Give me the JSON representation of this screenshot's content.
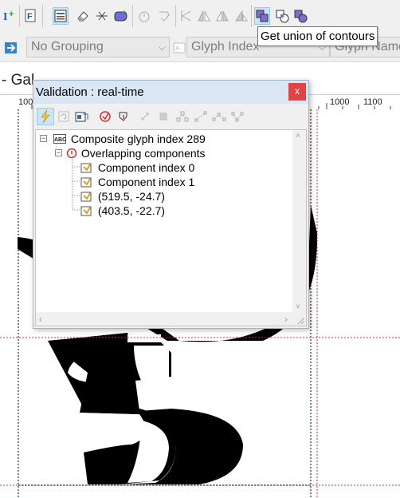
{
  "toolbar": {
    "tooltip": "Get union of contours",
    "icons": [
      "insert-point-icon",
      "font-info-icon",
      "glyph-list-icon",
      "eraser-icon",
      "split-icon",
      "add-component-icon",
      "timer-icon",
      "transform-icon",
      "align-left-icon",
      "flip-horizontal-icon",
      "flip-vertical-icon",
      "flip-mixed-icon",
      "union-contours-icon",
      "intersect-contours-icon",
      "subtract-contours-icon"
    ]
  },
  "grouping": {
    "selected": "No Grouping",
    "sort_field": "Glyph Index",
    "sort_field2": "Glyph Name"
  },
  "editor": {
    "tab_label": "- Gal",
    "ruler_labels": [
      "100",
      "1000",
      "1100"
    ]
  },
  "validation_panel": {
    "title": "Validation : real-time",
    "close_label": "x",
    "tree": [
      {
        "label": "Composite glyph index 289"
      },
      {
        "label": "Overlapping components"
      },
      {
        "label": "Component index 0"
      },
      {
        "label": "Component index 1"
      },
      {
        "label": "(519.5, -24.7)"
      },
      {
        "label": "(403.5, -22.7)"
      }
    ]
  },
  "colors": {
    "accent": "#3c82c4",
    "guide_red": "#d03030",
    "selected_tool_bg": "#cce4f7",
    "close_button": "#e04343"
  }
}
